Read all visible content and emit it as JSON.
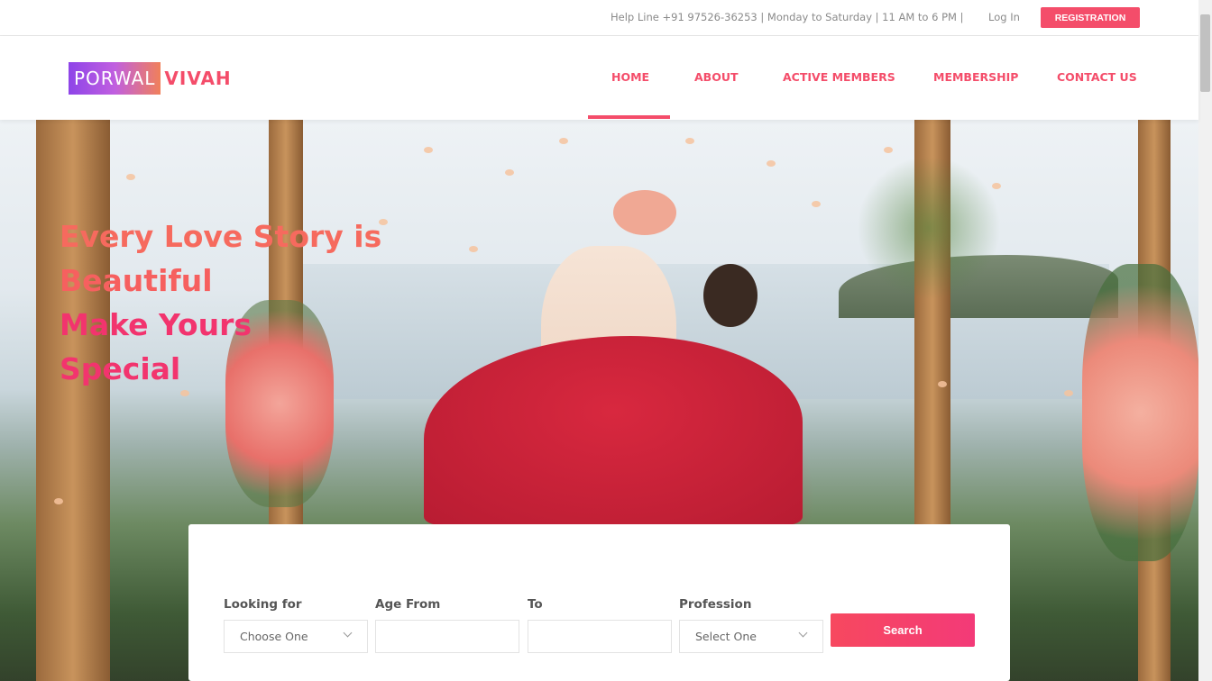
{
  "topbar": {
    "helpline": "Help Line +91 97526-36253 | Monday to Saturday | 11 AM to 6 PM |",
    "login": "Log In",
    "registration": "REGISTRATION"
  },
  "brand": {
    "part1": "PORWAL",
    "part2": "VIVAH"
  },
  "nav": [
    {
      "label": "HOME",
      "active": true
    },
    {
      "label": "ABOUT"
    },
    {
      "label": "ACTIVE MEMBERS"
    },
    {
      "label": "MEMBERSHIP"
    },
    {
      "label": "CONTACT US"
    }
  ],
  "hero": {
    "line1": "Every Love Story is",
    "line2": "Beautiful",
    "line3": "Make Yours",
    "line4": "Special"
  },
  "search": {
    "looking_for_label": "Looking for",
    "looking_for_value": "Choose One",
    "age_from_label": "Age From",
    "age_from_value": "",
    "to_label": "To",
    "to_value": "",
    "profession_label": "Profession",
    "profession_value": "Select One",
    "button": "Search"
  },
  "colors": {
    "accent": "#f44d6a",
    "accent2": "#f2346e"
  }
}
